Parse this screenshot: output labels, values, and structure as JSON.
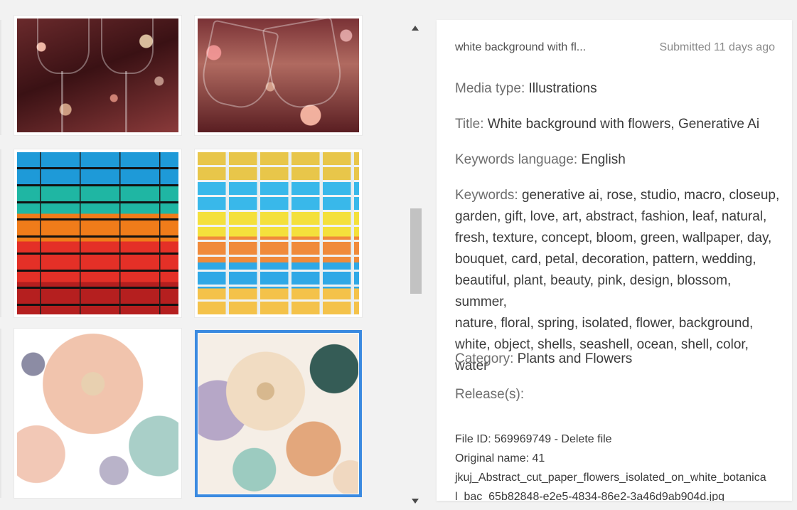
{
  "details": {
    "short_title": "white background with fl...",
    "submitted": "Submitted 11 days ago",
    "media_type_label": "Media type:",
    "media_type_value": "Illustrations",
    "title_label": "Title:",
    "title_value": "White background with flowers, Generative Ai",
    "keywords_language_label": "Keywords language:",
    "keywords_language_value": "English",
    "keywords_label": "Keywords:",
    "keywords_line1": "generative ai, rose, studio, macro, closeup,",
    "keywords_line2": "garden, gift, love, art, abstract, fashion, leaf, natural,",
    "keywords_line3": "fresh, texture, concept, bloom, green, wallpaper, day,",
    "keywords_line4": "bouquet, card, petal, decoration, pattern, wedding,",
    "keywords_line5": "beautiful, plant, beauty, pink, design, blossom, summer,",
    "keywords_line6": "nature, floral, spring, isolated, flower, background,",
    "keywords_line7": "white, object, shells, seashell, ocean, shell, color, water",
    "category_label": "Category:",
    "category_value": "Plants and Flowers",
    "releases_label": "Release(s):",
    "file_id_line": "File ID: 569969749 - Delete file",
    "original_name_line": "Original name: 41",
    "filename_line1": "jkuj_Abstract_cut_paper_flowers_isolated_on_white_botanica",
    "filename_line2": "l_bac_65b82848-e2e5-4834-86e2-3a46d9ab904d.jpg"
  },
  "thumbnails": [
    {
      "subject": "champagne glasses toast with bokeh",
      "selected": false
    },
    {
      "subject": "champagne glasses toast close-up",
      "selected": false
    },
    {
      "subject": "multicolored brick wall dark",
      "selected": false
    },
    {
      "subject": "multicolored brick wall light",
      "selected": false
    },
    {
      "subject": "paper cut flowers on white",
      "selected": false
    },
    {
      "subject": "paper cut flowers pastel",
      "selected": true
    }
  ],
  "colors": {
    "selection_border": "#3b8ae0",
    "background": "#f2f2f2",
    "panel": "#ffffff"
  }
}
